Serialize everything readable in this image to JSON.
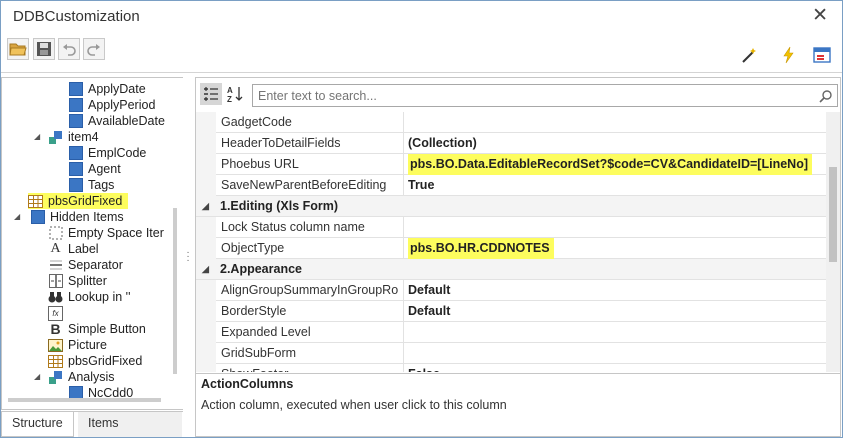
{
  "window": {
    "title": "DDBCustomization",
    "close_glyph": "✕"
  },
  "toolbar": {
    "icons": [
      "open-folder-icon",
      "save-icon",
      "undo-icon",
      "redo-icon",
      "magic-wand-icon",
      "lightning-icon",
      "layout-icon"
    ]
  },
  "tree": {
    "items": [
      {
        "label": "ApplyDate"
      },
      {
        "label": "ApplyPeriod"
      },
      {
        "label": "AvailableDate"
      },
      {
        "label": "item4",
        "expander": "◢"
      },
      {
        "label": "EmplCode"
      },
      {
        "label": "Agent"
      },
      {
        "label": "Tags"
      },
      {
        "label": "pbsGridFixed"
      },
      {
        "label": "Hidden Items",
        "expander": "◢"
      },
      {
        "label": "Empty Space Iter"
      },
      {
        "label": "Label"
      },
      {
        "label": "Separator"
      },
      {
        "label": "Splitter"
      },
      {
        "label": "Lookup in ''"
      },
      {
        "label": ""
      },
      {
        "label": "Simple Button"
      },
      {
        "label": "Picture"
      },
      {
        "label": "pbsGridFixed"
      },
      {
        "label": "Analysis",
        "expander": "◢"
      },
      {
        "label": "NcCdd0"
      }
    ],
    "icon_glyphs": {
      "label": "A",
      "button": "B",
      "function": "fx"
    }
  },
  "tabs": [
    {
      "label": "Structure",
      "active": true
    },
    {
      "label": "Items",
      "active": false
    }
  ],
  "search": {
    "placeholder": "Enter text to search..."
  },
  "grid": {
    "rows": [
      {
        "name": "GadgetCode",
        "value": ""
      },
      {
        "name": "HeaderToDetailFields",
        "value": "(Collection)"
      },
      {
        "name": "Phoebus URL",
        "value": "pbs.BO.Data.EditableRecordSet?$code=CV&CandidateID=[LineNo]",
        "highlight": true
      },
      {
        "name": "SaveNewParentBeforeEditing",
        "value": "True"
      }
    ],
    "cat1": {
      "label": "1.Editing (Xls Form)",
      "arrow": "◢"
    },
    "rows2": [
      {
        "name": "Lock Status column name",
        "value": ""
      },
      {
        "name": "ObjectType",
        "value": "pbs.BO.HR.CDDNOTES",
        "highlight": true
      }
    ],
    "cat2": {
      "label": "2.Appearance",
      "arrow": "◢"
    },
    "rows3": [
      {
        "name": "AlignGroupSummaryInGroupRo",
        "value": "Default"
      },
      {
        "name": "BorderStyle",
        "value": "Default"
      },
      {
        "name": "Expanded Level",
        "value": ""
      },
      {
        "name": "GridSubForm",
        "value": ""
      },
      {
        "name": "ShowFooter",
        "value": "False"
      }
    ]
  },
  "description": {
    "title": "ActionColumns",
    "text": "Action column, executed when user click to this column"
  },
  "colors": {
    "highlight": "#fdfd5e",
    "accent": "#3b76c4"
  }
}
